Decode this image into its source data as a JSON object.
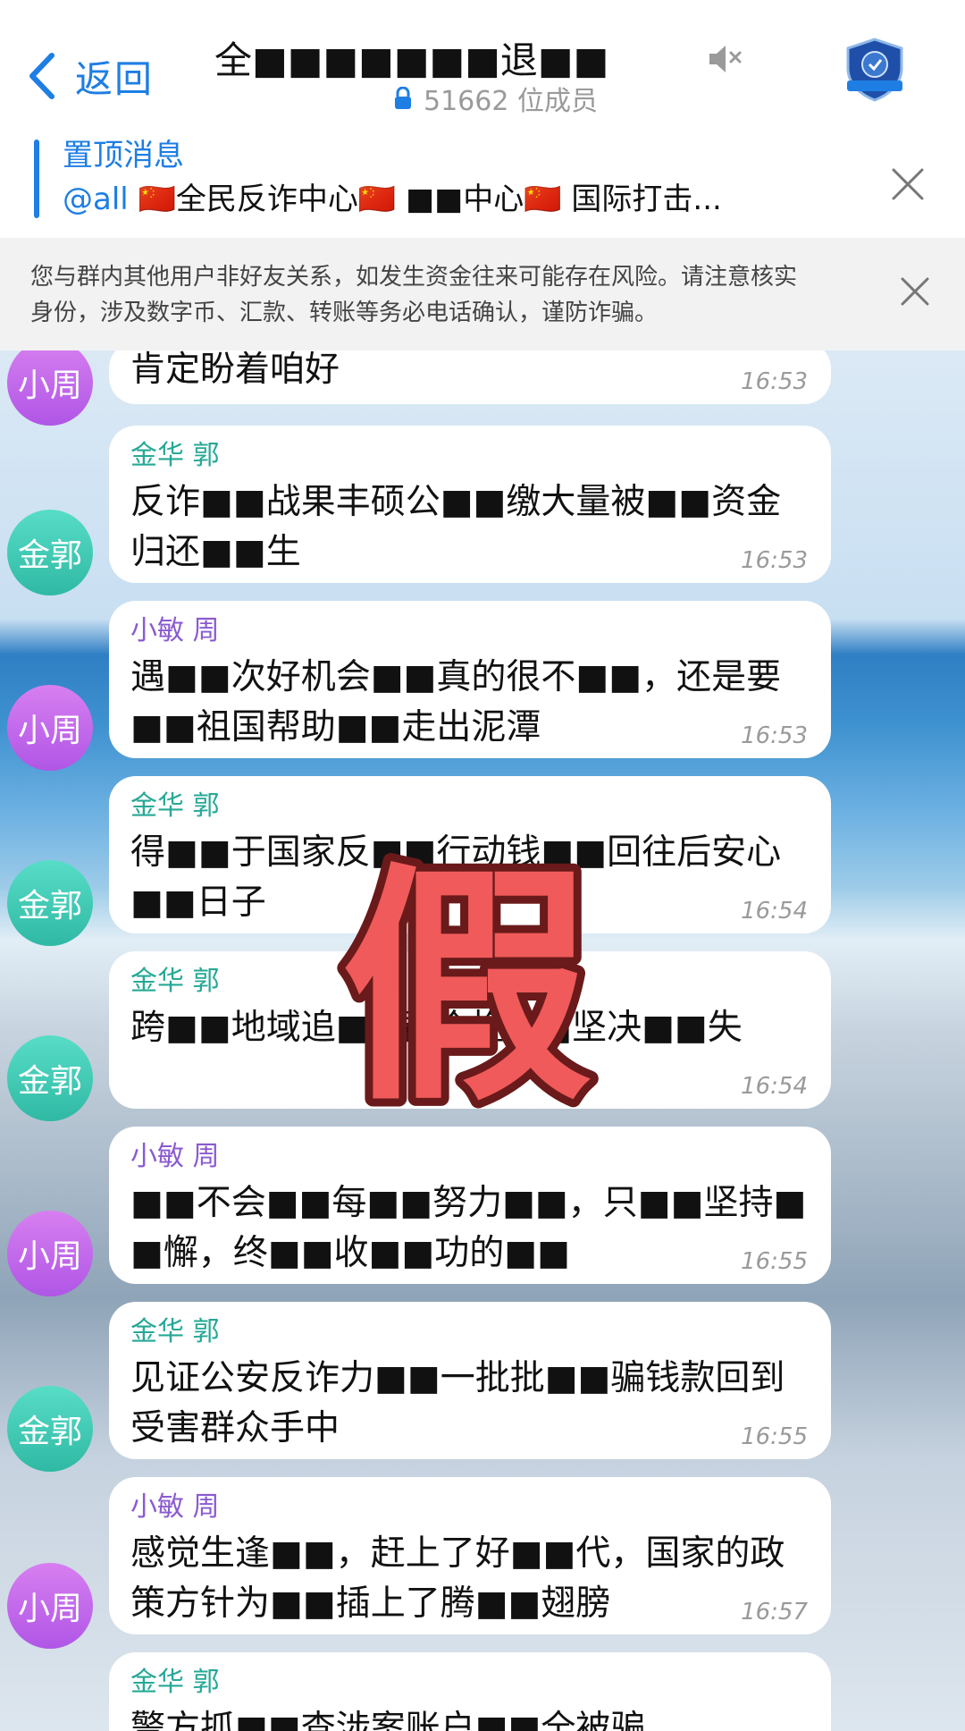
{
  "nav": {
    "back_label": "返回",
    "title": "全■■■■■■■退■■",
    "member_count": "51662 位成员"
  },
  "pinned": {
    "title": "置顶消息",
    "mention": "@all",
    "text": " 🇨🇳全民反诈中心🇨🇳 ■■中心🇨🇳 国际打击..."
  },
  "warning": {
    "line1": "您与群内其他用户非好友关系，如发生资金往来可能存在风险。请注意核实",
    "line2": "身份，涉及数字币、汇款、转账等务必电话确认，谨防诈骗。"
  },
  "stamp": {
    "text": "假",
    "color": "#f05a5a",
    "outline": "#6a1a1a"
  },
  "messages": [
    {
      "avatar": "小周",
      "sender": "",
      "text": "肯定盼着咱好",
      "time": "16:53"
    },
    {
      "avatar": "金郭",
      "sender": "金华 郭",
      "text": "反诈■■战果丰硕公■■缴大量被■■资金归还■■生",
      "time": "16:53"
    },
    {
      "avatar": "小周",
      "sender": "小敏 周",
      "text": "遇■■次好机会■■真的很不■■，还是要■■祖国帮助■■走出泥潭",
      "time": "16:53"
    },
    {
      "avatar": "金郭",
      "sender": "金华 郭",
      "text": "得■■于国家反■■行动钱■■回往后安心■■日子",
      "time": "16:54"
    },
    {
      "avatar": "金郭",
      "sender": "金华 郭",
      "text": "跨■■地域追■■群众挽■■坚决■■失",
      "time": "16:54"
    },
    {
      "avatar": "小周",
      "sender": "小敏 周",
      "text": "■■不会■■每■■努力■■，只■■坚持■■懈，终■■收■■功的■■",
      "time": "16:55"
    },
    {
      "avatar": "金郭",
      "sender": "金华 郭",
      "text": "见证公安反诈力■■一批批■■骗钱款回到受害群众手中",
      "time": "16:55"
    },
    {
      "avatar": "小周",
      "sender": "小敏 周",
      "text": "感觉生逢■■，赶上了好■■代，国家的政策方针为■■插上了腾■■翅膀",
      "time": "16:57"
    },
    {
      "avatar": "金郭",
      "sender": "金华 郭",
      "text": "警方抓■■查涉案账户■■全被骗",
      "time": ""
    }
  ]
}
